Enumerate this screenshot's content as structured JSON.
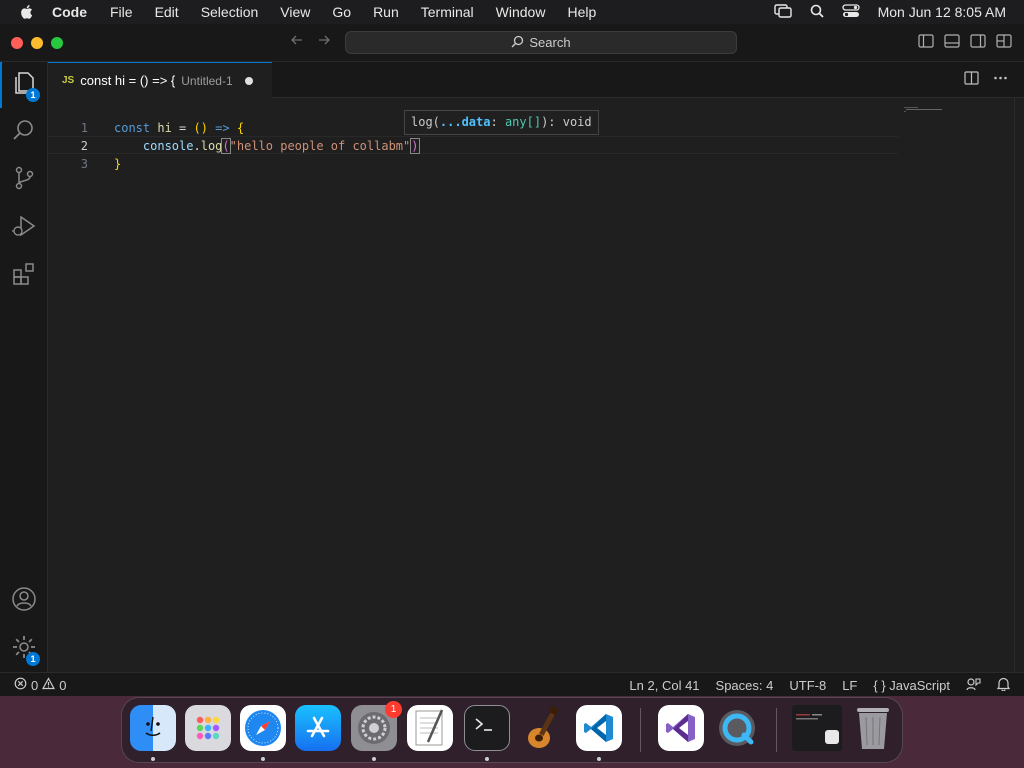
{
  "menubar": {
    "app_name": "Code",
    "menus": [
      "File",
      "Edit",
      "Selection",
      "View",
      "Go",
      "Run",
      "Terminal",
      "Window",
      "Help"
    ],
    "clock": "Mon Jun 12  8:05 AM"
  },
  "titlebar": {
    "search_label": "Search"
  },
  "activitybar": {
    "explorer_badge": "1",
    "settings_badge": "1"
  },
  "tab": {
    "lang_badge": "JS",
    "title": "const hi = () => {",
    "description": "Untitled-1"
  },
  "editor": {
    "line_numbers": [
      "1",
      "2",
      "3"
    ],
    "line1": {
      "kw": "const",
      "name": "hi",
      "eq": " = ",
      "parens": "()",
      "arrow": " => ",
      "brace": "{"
    },
    "line2": {
      "indent": "    ",
      "obj": "console",
      "dot": ".",
      "method": "log",
      "open": "(",
      "string": "\"hello people of collabm\"",
      "close": ")"
    },
    "line3": {
      "brace": "}"
    },
    "hover": {
      "fn": "log(",
      "param": "...data",
      "colon": ": ",
      "type": "any[]",
      "rest": "): void"
    }
  },
  "statusbar": {
    "errors": "0",
    "warnings": "0",
    "position": "Ln 2, Col 41",
    "spaces": "Spaces: 4",
    "encoding": "UTF-8",
    "eol": "LF",
    "language_braces": "{ }",
    "language": "JavaScript"
  },
  "dock": {
    "settings_badge": "1"
  },
  "colors": {
    "accent": "#0078d4",
    "editor_bg": "#1f1f1f",
    "keyword": "#569cd6",
    "string": "#ce9178"
  }
}
